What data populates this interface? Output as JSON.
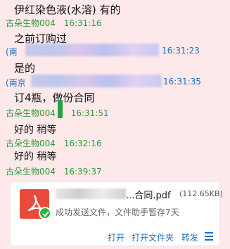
{
  "messages": [
    {
      "text": "伊红染色液(水溶)  有的"
    },
    {
      "sender": "古朵生物004",
      "time": "16:31:16"
    },
    {
      "text": "之前订购过"
    },
    {
      "sender": "(南",
      "time": "16:31:23"
    },
    {
      "text": "是的"
    },
    {
      "sender": "(南京",
      "time": "16:31:35"
    },
    {
      "text": "订4瓶，做份合同"
    },
    {
      "sender": "古朵生物004",
      "time": "16:31:51"
    },
    {
      "text": "好的 稍等"
    },
    {
      "sender": "古朵生物004",
      "time": "16:32:16"
    },
    {
      "text": "好的 稍等"
    },
    {
      "sender": "古朵生物004",
      "time": "16:39:37"
    }
  ],
  "file": {
    "name": "...合同.pdf",
    "size": "(112.65KB)",
    "status": "成功发送文件，文件助手暂存7天",
    "actions": {
      "open": "打开",
      "open_folder": "打开文件夹",
      "forward": "转发"
    },
    "icon": "pdf-icon",
    "status_icon": "check-icon"
  },
  "colors": {
    "background": "#fde9ea",
    "sender_self": "#2e9a3a",
    "sender_other": "#1f6fbf",
    "pdf": "#e84b3c"
  }
}
